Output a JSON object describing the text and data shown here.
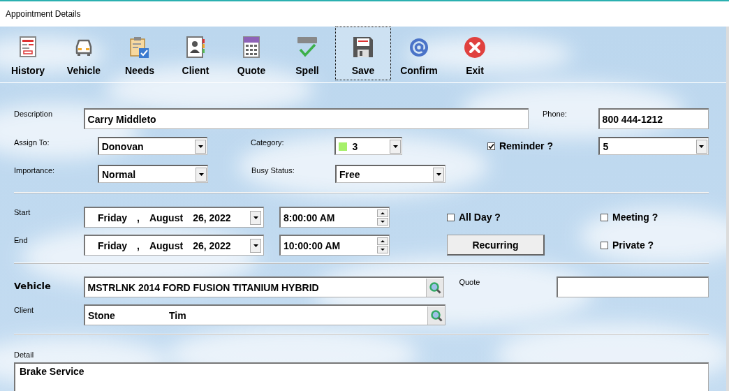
{
  "window": {
    "title": "Appointment Details"
  },
  "toolbar": [
    {
      "label": "History",
      "kind": "history",
      "selected": false
    },
    {
      "label": "Vehicle",
      "kind": "vehicle",
      "selected": false
    },
    {
      "label": "Needs",
      "kind": "needs",
      "selected": false
    },
    {
      "label": "Client",
      "kind": "client",
      "selected": false
    },
    {
      "label": "Quote",
      "kind": "quote",
      "selected": false
    },
    {
      "label": "Spell",
      "kind": "spell",
      "selected": false
    },
    {
      "label": "Save",
      "kind": "save",
      "selected": true
    },
    {
      "label": "Confirm",
      "kind": "confirm",
      "selected": false
    },
    {
      "label": "Exit",
      "kind": "exit",
      "selected": false
    }
  ],
  "description": {
    "label": "Description",
    "value": "Carry Middleto"
  },
  "phone": {
    "label": "Phone:",
    "value": "800 444-1212"
  },
  "assign_to": {
    "label": "Assign To:",
    "value": "Donovan"
  },
  "category": {
    "label": "Category:",
    "value": "3",
    "color": "#a6f06a"
  },
  "reminder": {
    "label": "Reminder ?",
    "checked": true
  },
  "reminder_time": {
    "value": "5"
  },
  "importance": {
    "label": "Importance:",
    "value": "Normal"
  },
  "busy_status": {
    "label": "Busy Status:",
    "value": "Free"
  },
  "start": {
    "label": "Start",
    "date_parts": [
      "Friday",
      ",",
      "August",
      "26, 2022"
    ],
    "time": "8:00:00 AM"
  },
  "end": {
    "label": "End",
    "date_parts": [
      "Friday",
      ",",
      "August",
      "26, 2022"
    ],
    "time": "10:00:00 AM"
  },
  "all_day": {
    "label": "All Day ?",
    "checked": false
  },
  "meeting": {
    "label": "Meeting ?",
    "checked": false
  },
  "private": {
    "label": "Private ?",
    "checked": false
  },
  "recurring_button": {
    "label": "Recurring"
  },
  "vehicle": {
    "label": "Vehicle",
    "value": "MSTRLNK 2014 FORD FUSION TITANIUM HYBRID"
  },
  "quote": {
    "label": "Quote"
  },
  "client": {
    "label": "Client",
    "last_name": "Stone",
    "first_name": "Tim"
  },
  "detail": {
    "label": "Detail",
    "value": "Brake Service"
  }
}
